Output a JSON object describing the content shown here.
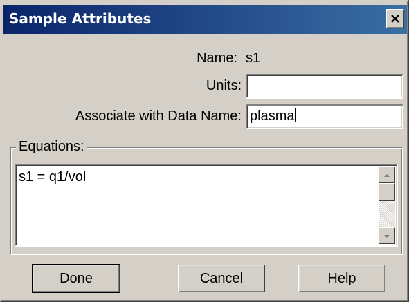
{
  "window": {
    "title": "Sample Attributes"
  },
  "form": {
    "name_label": "Name:",
    "name_value": "s1",
    "units_label": "Units:",
    "units_value": "",
    "associate_label": "Associate with Data Name:",
    "associate_value": "plasma"
  },
  "equations": {
    "legend": "Equations:",
    "text": "s1 = q1/vol"
  },
  "buttons": {
    "done": "Done",
    "cancel": "Cancel",
    "help": "Help"
  },
  "icons": {
    "close": "close-icon",
    "scroll_up": "arrow-up-icon",
    "scroll_down": "arrow-down-icon"
  },
  "colors": {
    "titlebar_start": "#0a246a",
    "titlebar_end": "#3a6ea5",
    "face": "#d4d0c8"
  }
}
